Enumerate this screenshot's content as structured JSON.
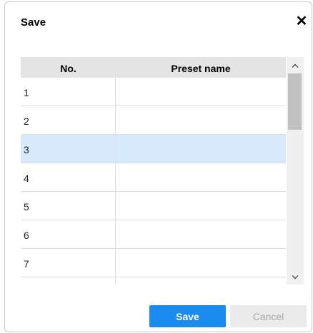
{
  "dialog": {
    "title": "Save",
    "close_icon": "close-icon"
  },
  "table": {
    "headers": {
      "no": "No.",
      "name": "Preset name"
    },
    "rows": [
      {
        "no": "1",
        "name": ""
      },
      {
        "no": "2",
        "name": ""
      },
      {
        "no": "3",
        "name": ""
      },
      {
        "no": "4",
        "name": ""
      },
      {
        "no": "5",
        "name": ""
      },
      {
        "no": "6",
        "name": ""
      },
      {
        "no": "7",
        "name": ""
      }
    ],
    "selected_row": "3"
  },
  "scrollbar": {
    "up_icon": "chevron-up-icon",
    "down_icon": "chevron-down-icon"
  },
  "buttons": {
    "save_label": "Save",
    "cancel_label": "Cancel"
  },
  "colors": {
    "accent": "#1a8cf0",
    "selected_row": "#d6eafc",
    "header_bg": "#e4e4e4"
  }
}
